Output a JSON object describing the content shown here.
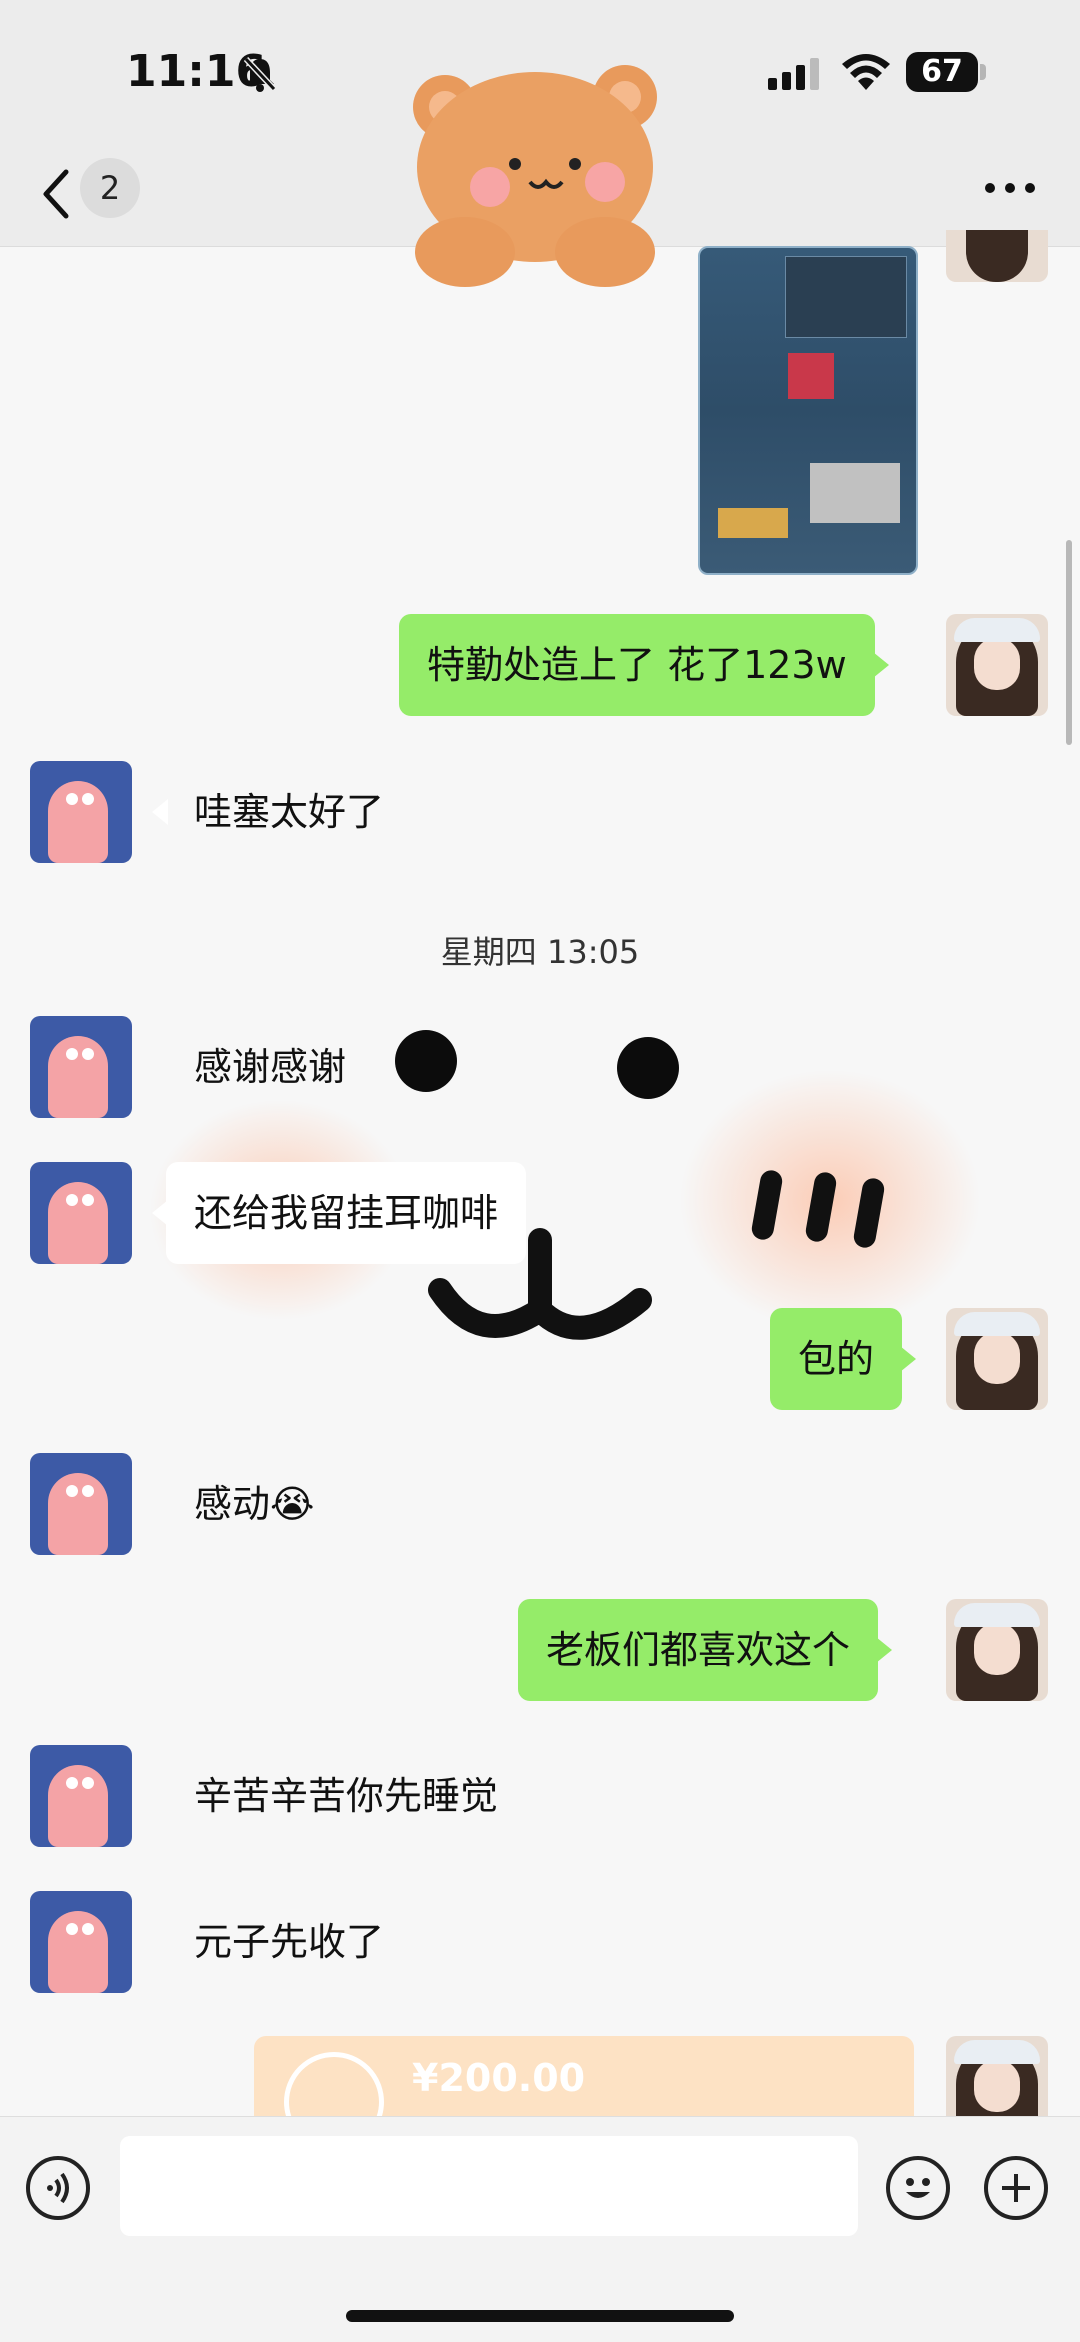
{
  "status": {
    "time": "11:16",
    "battery": "67"
  },
  "nav": {
    "unread_count": "2"
  },
  "messages": [
    {
      "side": "right",
      "type": "text",
      "text": "特勤处造上了 花了123w"
    },
    {
      "side": "left",
      "type": "text",
      "text": "哇塞太好了"
    },
    {
      "side": "system",
      "type": "timestamp",
      "text": "星期四 13:05"
    },
    {
      "side": "left",
      "type": "text",
      "text": "感谢感谢"
    },
    {
      "side": "left",
      "type": "text",
      "text": "还给我留挂耳咖啡"
    },
    {
      "side": "right",
      "type": "text",
      "text": "包的"
    },
    {
      "side": "left",
      "type": "text",
      "text": "感动😭"
    },
    {
      "side": "right",
      "type": "text",
      "text": "老板们都喜欢这个"
    },
    {
      "side": "left",
      "type": "text",
      "text": "辛苦辛苦你先睡觉"
    },
    {
      "side": "left",
      "type": "text",
      "text": "元子先收了"
    },
    {
      "side": "right",
      "type": "transfer",
      "text": "¥200.00"
    }
  ],
  "input": {
    "placeholder": ""
  },
  "colors": {
    "bubble_green": "#95ec69",
    "transfer_bg": "#fde2c4"
  },
  "icons": [
    "bell-slash-icon",
    "signal-icon",
    "wifi-icon",
    "back-chevron-icon",
    "more-icon",
    "voice-icon",
    "emoji-icon",
    "plus-icon"
  ]
}
